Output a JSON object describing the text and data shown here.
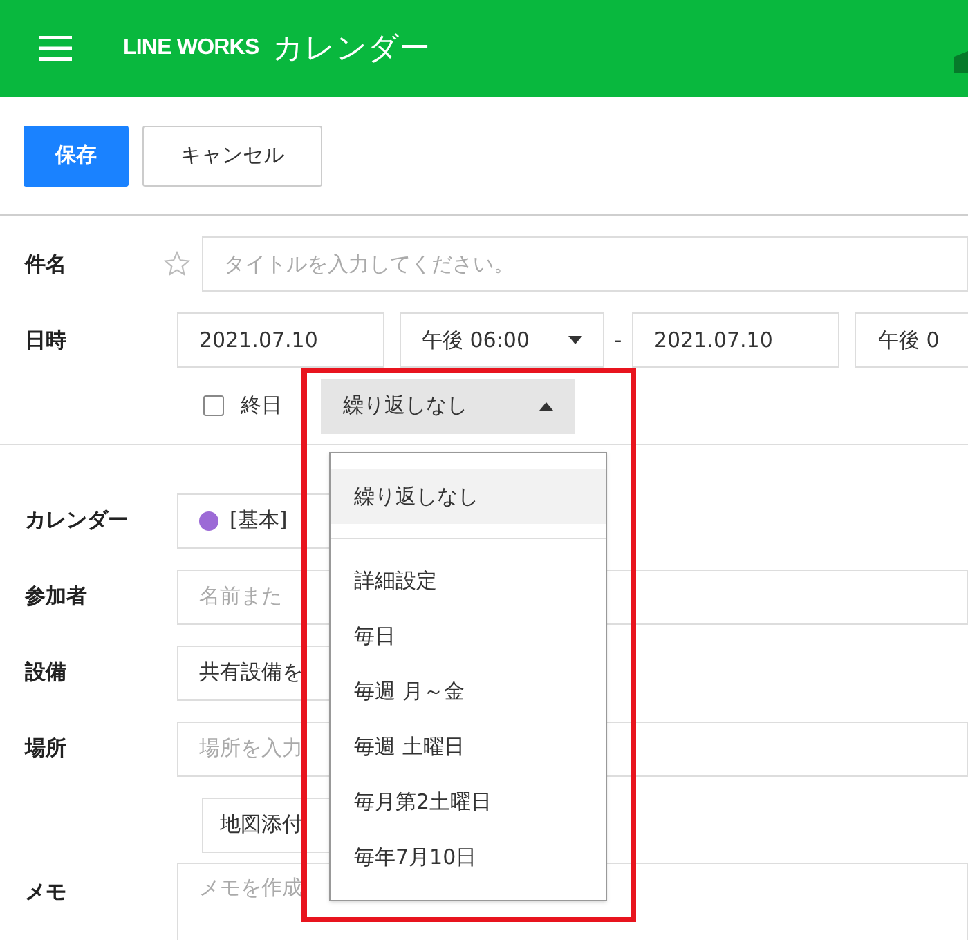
{
  "header": {
    "brand": "LINE WORKS",
    "title": "カレンダー"
  },
  "toolbar": {
    "save": "保存",
    "cancel": "キャンセル"
  },
  "subject": {
    "label": "件名",
    "starred": false,
    "placeholder": "タイトルを入力してください。"
  },
  "datetime": {
    "label": "日時",
    "start_date": "2021.07.10",
    "start_time": "午後 06:00",
    "separator": "-",
    "end_date": "2021.07.10",
    "end_time": "午後 0",
    "all_day": {
      "label": "終日",
      "checked": false
    },
    "repeat": {
      "value": "繰り返しなし",
      "expanded": true
    }
  },
  "calendar": {
    "label": "カレンダー",
    "value": "[基本]",
    "color": "#9c6ad6"
  },
  "attendees": {
    "label": "参加者",
    "placeholder": "名前また"
  },
  "facility": {
    "label": "設備",
    "value": "共有設備を"
  },
  "place": {
    "label": "場所",
    "placeholder": "場所を入力",
    "map_button": "地図添付"
  },
  "memo": {
    "label": "メモ",
    "placeholder": "メモを作成"
  },
  "repeat_menu": [
    {
      "label": "繰り返しなし",
      "selected": true
    },
    {
      "label": "詳細設定",
      "selected": false
    },
    {
      "label": "毎日",
      "selected": false
    },
    {
      "label": "毎週 月～金",
      "selected": false
    },
    {
      "label": "毎週 土曜日",
      "selected": false
    },
    {
      "label": "毎月第2土曜日",
      "selected": false
    },
    {
      "label": "毎年7月10日",
      "selected": false
    }
  ]
}
